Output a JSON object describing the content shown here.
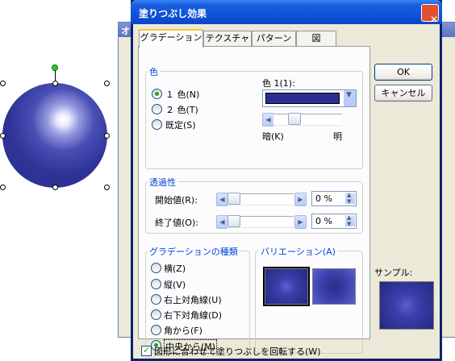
{
  "background_dialog": {
    "title_partial": "オ"
  },
  "dialog": {
    "title": "塗りつぶし効果",
    "close_glyph": "✕",
    "tabs": [
      {
        "label": "グラデーション",
        "selected": true
      },
      {
        "label": "テクスチャ",
        "selected": false
      },
      {
        "label": "パターン",
        "selected": false
      },
      {
        "label": "図",
        "selected": false
      }
    ],
    "color_section": {
      "title": "色",
      "options": [
        {
          "label": "１ 色(N)",
          "selected": true
        },
        {
          "label": "２ 色(T)",
          "selected": false
        },
        {
          "label": "既定(S)",
          "selected": false
        }
      ],
      "color1_label": "色 1(1):",
      "color1_value": "#2b2f93",
      "dark_label": "暗(K)",
      "light_label": "明",
      "slider_value": 0.25
    },
    "transparency_section": {
      "title": "透過性",
      "start_label": "開始値(R):",
      "start_value": "0 %",
      "end_label": "終了値(O):",
      "end_value": "0 %"
    },
    "gradient_type": {
      "title": "グラデーションの種類",
      "options": [
        {
          "label": "横(Z)",
          "selected": false
        },
        {
          "label": "縦(V)",
          "selected": false
        },
        {
          "label": "右上対角線(U)",
          "selected": false
        },
        {
          "label": "右下対角線(D)",
          "selected": false
        },
        {
          "label": "角から(F)",
          "selected": false
        },
        {
          "label": "中央から(M)",
          "selected": true
        }
      ]
    },
    "variation": {
      "title": "バリエーション(A)"
    },
    "ok_label": "OK",
    "cancel_label": "キャンセル",
    "sample_label": "サンプル:",
    "rotate_checkbox": {
      "label": "図形に合わせて塗りつぶしを回転する(W)",
      "checked": true
    }
  },
  "colors": {
    "accent_green": "#21a121",
    "group_title": "#0046d5",
    "title_bar": "#0f4fd6"
  }
}
